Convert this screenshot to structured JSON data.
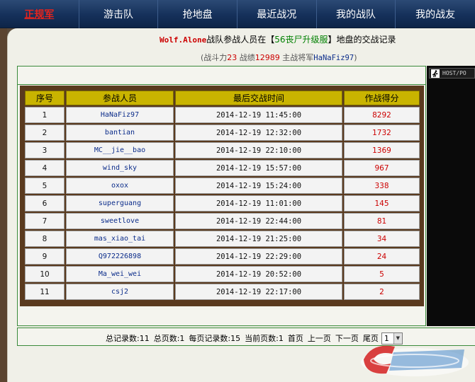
{
  "nav": {
    "items": [
      {
        "label": "正规军",
        "active": true
      },
      {
        "label": "游击队",
        "active": false
      },
      {
        "label": "抢地盘",
        "active": false
      },
      {
        "label": "最近战况",
        "active": false
      },
      {
        "label": "我的战队",
        "active": false
      },
      {
        "label": "我的战友",
        "active": false
      }
    ]
  },
  "header": {
    "team_name": "Wolf.Alone",
    "title_mid": "战队参战人员在【",
    "server_name": "56丧尸升级服",
    "title_end": "】地盘的交战记录",
    "sub_prefix": "(战斗力",
    "power": "23",
    "record_label": " 战绩",
    "record": "12989",
    "commander_label": " 主战将军",
    "commander": "HaNaFiz97",
    "sub_suffix": ")"
  },
  "table": {
    "headers": [
      "序号",
      "参战人员",
      "最后交战时间",
      "作战得分"
    ],
    "rows": [
      {
        "idx": "1",
        "player": "HaNaFiz97",
        "time": "2014-12-19 11:45:00",
        "score": "8292"
      },
      {
        "idx": "2",
        "player": "bantian",
        "time": "2014-12-19 12:32:00",
        "score": "1732"
      },
      {
        "idx": "3",
        "player": "MC__jie__bao",
        "time": "2014-12-19 22:10:00",
        "score": "1369"
      },
      {
        "idx": "4",
        "player": "wind_sky",
        "time": "2014-12-19 15:57:00",
        "score": "967"
      },
      {
        "idx": "5",
        "player": "oxox",
        "time": "2014-12-19 15:24:00",
        "score": "338"
      },
      {
        "idx": "6",
        "player": "superguang",
        "time": "2014-12-19 11:01:00",
        "score": "145"
      },
      {
        "idx": "7",
        "player": "sweetlove",
        "time": "2014-12-19 22:44:00",
        "score": "81"
      },
      {
        "idx": "8",
        "player": "mas_xiao_tai",
        "time": "2014-12-19 21:25:00",
        "score": "34"
      },
      {
        "idx": "9",
        "player": "Q972226898",
        "time": "2014-12-19 22:29:00",
        "score": "24"
      },
      {
        "idx": "10",
        "player": "Ma_wei_wei",
        "time": "2014-12-19 20:52:00",
        "score": "5"
      },
      {
        "idx": "11",
        "player": "csj2",
        "time": "2014-12-19 22:17:00",
        "score": "2"
      }
    ]
  },
  "pager": {
    "total_records": "总记录数:11",
    "total_pages": "总页数:1",
    "per_page": "每页记录数:15",
    "current_page": "当前页数:1",
    "first": "首页",
    "prev": "上一页",
    "next": "下一页",
    "last": "尾页",
    "selected_page": "1"
  },
  "side_panel": {
    "tab_label": "HOST/PO"
  },
  "colors": {
    "nav_bg": "#15305a",
    "active_nav": "#e8231c",
    "table_header": "#c9b400",
    "table_border": "#5a3a1e",
    "score": "#cc0000",
    "player": "#0b2c8a",
    "green_frame": "#3a8a3a"
  }
}
